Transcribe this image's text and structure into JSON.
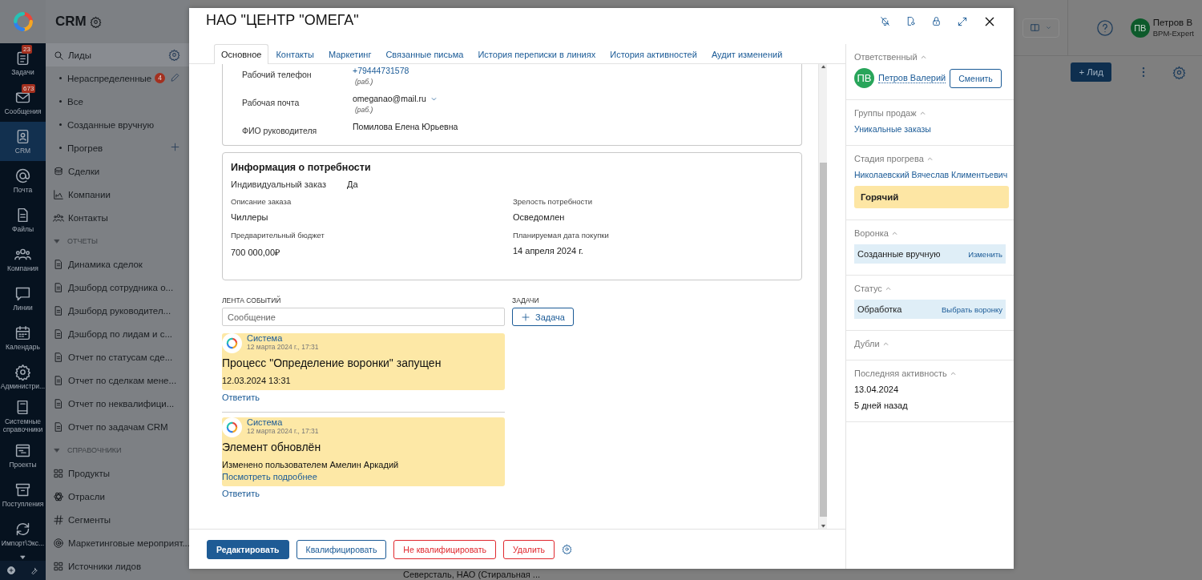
{
  "rail": {
    "items": [
      {
        "label": "Задачи",
        "badge": "23",
        "selected": false
      },
      {
        "label": "Сообщения",
        "badge": "673",
        "selected": false
      },
      {
        "label": "CRM",
        "selected": true
      },
      {
        "label": "Почта",
        "selected": false
      },
      {
        "label": "Файлы",
        "selected": false
      },
      {
        "label": "Компания",
        "selected": false
      },
      {
        "label": "Линии",
        "selected": false
      },
      {
        "label": "Календарь",
        "selected": false
      },
      {
        "label": "Администри...",
        "selected": false
      },
      {
        "label": "Системные справочники",
        "selected": false
      },
      {
        "label": "Проекты",
        "selected": false
      },
      {
        "label": "Поступления",
        "selected": false
      },
      {
        "label": "Импорт\\Экс...",
        "selected": false
      }
    ]
  },
  "sidebar": {
    "title": "CRM",
    "items": [
      {
        "kind": "link",
        "label": "Лиды",
        "selected": true,
        "children": [
          {
            "label": "Нераспределенные",
            "badge": "4",
            "selected": false
          },
          {
            "label": "Все",
            "selected": false
          },
          {
            "label": "Созданные вручную",
            "selected": false
          },
          {
            "label": "Прогрев",
            "selected": false
          }
        ]
      },
      {
        "kind": "link",
        "label": "Сделки",
        "selected": false
      },
      {
        "kind": "link",
        "label": "Компании",
        "selected": false
      },
      {
        "kind": "link",
        "label": "Контакты",
        "selected": false
      },
      {
        "kind": "group",
        "label": "ОТЧЕТЫ",
        "expanded": true,
        "children": [
          {
            "label": "Динамика сделок",
            "selected": false
          },
          {
            "label": "Дэшборд сотрудника о...",
            "selected": false
          },
          {
            "label": "Дэшборд руководител...",
            "selected": false
          },
          {
            "label": "Дэшборд по лидам и с...",
            "selected": false
          },
          {
            "label": "Отчет по статусам сде...",
            "selected": false
          },
          {
            "label": "Отчет по сделкам мене...",
            "selected": false
          },
          {
            "label": "Отчет по неквалифици...",
            "selected": false
          },
          {
            "label": "Отчет по задачам CRM",
            "selected": false
          }
        ]
      },
      {
        "kind": "group",
        "label": "СПРАВОЧНИКИ",
        "expanded": true,
        "children": [
          {
            "label": "Продукты",
            "selected": false
          },
          {
            "label": "Отрасли",
            "selected": false
          },
          {
            "label": "Сегменты",
            "selected": false
          },
          {
            "label": "Маркетинговые мероприят...",
            "selected": false
          },
          {
            "label": "Источники лидов",
            "selected": false
          }
        ]
      }
    ]
  },
  "header": {
    "user": {
      "initials": "ПВ",
      "name": "Петров В",
      "role": "BPM-Expert"
    }
  },
  "toolbar": {
    "add_button": "+ Лид"
  },
  "list_row": "Северсталь, НАО (Стиральная ...",
  "modal": {
    "title": "НАО \"ЦЕНТР \"ОМЕГА\"",
    "tabs": [
      {
        "label": "Основное",
        "selected": true
      },
      {
        "label": "Контакты",
        "selected": false
      },
      {
        "label": "Маркетинг",
        "selected": false
      },
      {
        "label": "Связанные письма",
        "selected": false
      },
      {
        "label": "История переписки в линиях",
        "selected": false
      },
      {
        "label": "История активностей",
        "selected": false
      },
      {
        "label": "Аудит изменений",
        "selected": false
      }
    ],
    "contact_fields": [
      {
        "kind": "phone",
        "label": "Рабочий телефон",
        "value": "+79444731578",
        "note": "(раб.)"
      },
      {
        "kind": "email",
        "label": "Рабочая почта",
        "value": "omeganao@mail.ru",
        "note": "(раб.)"
      },
      {
        "kind": "text",
        "label": "ФИО руководителя",
        "value": "Помилова Елена Юрьевна"
      }
    ],
    "need_info": {
      "title": "Информация о потребности",
      "individual": {
        "label": "Индивидуальный заказ",
        "value": "Да"
      },
      "fields": [
        {
          "label": "Описание заказа",
          "value": "Чиллеры"
        },
        {
          "label": "Зрелость потребности",
          "value": "Осведомлен"
        },
        {
          "label": "Предварительный бюджет",
          "value": "700 000,00₽"
        },
        {
          "label": "Планируемая дата покупки",
          "value": "14 апреля 2024 г."
        }
      ]
    },
    "feed": {
      "label": "ЛЕНТА СОБЫТИЙ",
      "placeholder": "Сообщение",
      "events": [
        {
          "author": "Система",
          "time": "12 марта 2024 г., 17:31",
          "title": "Процесс \"Определение воронки\" запущен",
          "body": "12.03.2024 13:31",
          "reply": "Ответить"
        },
        {
          "author": "Система",
          "time": "12 марта 2024 г., 17:31",
          "title": "Элемент обновлён",
          "body": "Изменено пользователем Амелин Аркадий",
          "link": "Посмотреть подробнее",
          "reply": "Ответить"
        }
      ]
    },
    "tasks": {
      "label": "ЗАДАЧИ",
      "button": "Задача"
    },
    "actions": [
      {
        "label": "Редактировать",
        "kind": "primary"
      },
      {
        "label": "Квалифицировать",
        "kind": "secondary"
      },
      {
        "label": "Не квалифицировать",
        "kind": "danger"
      },
      {
        "label": "Удалить",
        "kind": "danger"
      }
    ],
    "side": [
      {
        "kind": "person",
        "title": "Ответственный",
        "expanded": true,
        "initials": "ПВ",
        "name": "Петров Валерий",
        "button": "Сменить"
      },
      {
        "kind": "link",
        "title": "Группы продаж",
        "expanded": true,
        "value": "Уникальные заказы"
      },
      {
        "kind": "stage",
        "title": "Стадия прогрева",
        "expanded": true,
        "value": "Николаевский Вячеслав Климентьевич",
        "stage": "Горячий"
      },
      {
        "kind": "choice",
        "title": "Воронка",
        "expanded": true,
        "value": "Созданные вручную",
        "action": "Изменить"
      },
      {
        "kind": "choice",
        "title": "Статус",
        "expanded": true,
        "value": "Обработка",
        "action": "Выбрать воронку"
      },
      {
        "kind": "empty",
        "title": "Дубли",
        "expanded": true
      },
      {
        "kind": "lines",
        "title": "Последняя активность",
        "expanded": true,
        "lines": [
          "13.04.2024",
          "5 дней назад"
        ]
      }
    ]
  }
}
